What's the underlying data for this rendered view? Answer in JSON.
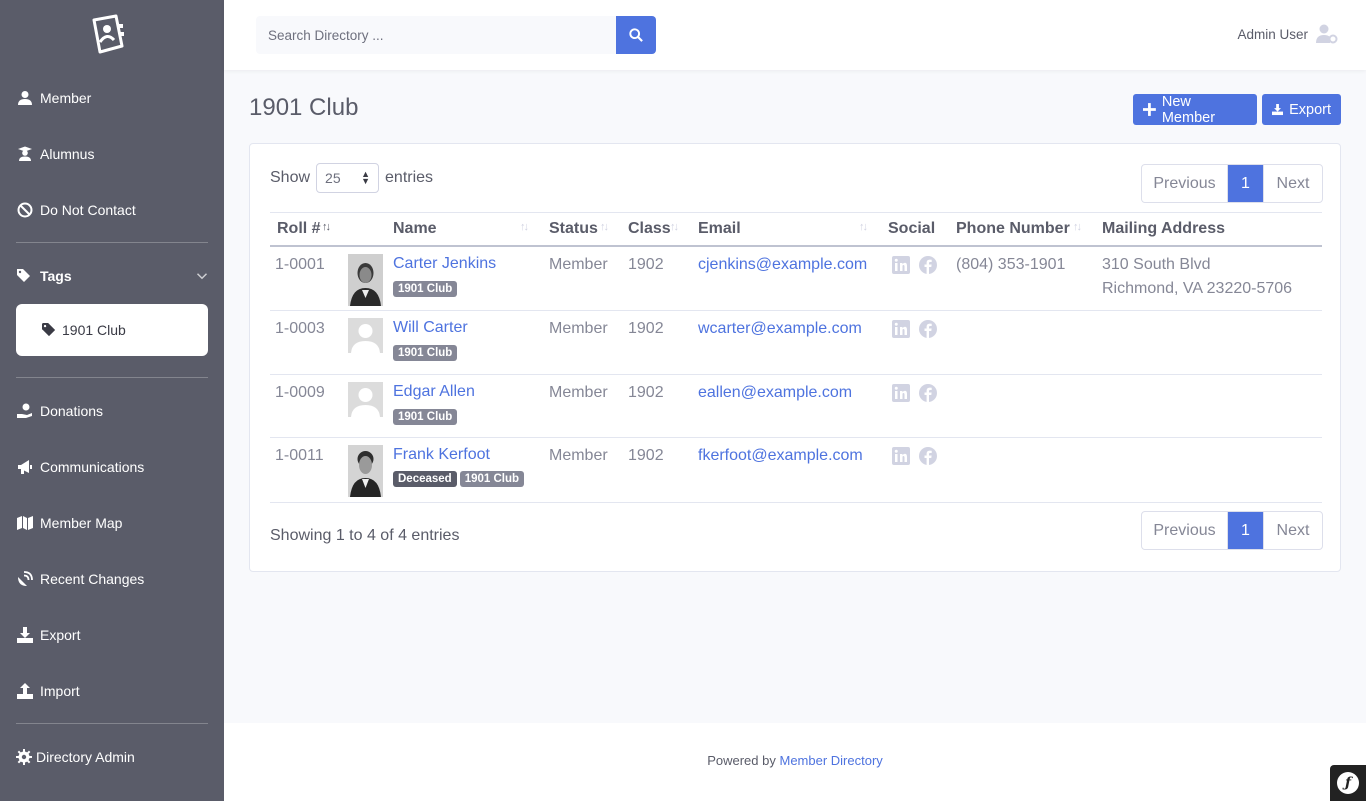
{
  "sidebar": {
    "brand_icon": "contact-book-icon",
    "items": [
      {
        "label": "Member",
        "icon": "user-icon"
      },
      {
        "label": "Alumnus",
        "icon": "graduate-icon"
      },
      {
        "label": "Do Not Contact",
        "icon": "ban-icon"
      },
      {
        "label": "Tags",
        "icon": "tags-icon"
      },
      {
        "label": "1901 Club",
        "icon": "tag-icon"
      },
      {
        "label": "Donations",
        "icon": "donate-icon"
      },
      {
        "label": "Communications",
        "icon": "bullhorn-icon"
      },
      {
        "label": "Member Map",
        "icon": "map-icon"
      },
      {
        "label": "Recent Changes",
        "icon": "satellite-dish-icon"
      },
      {
        "label": "Export",
        "icon": "download-icon"
      },
      {
        "label": "Import",
        "icon": "upload-icon"
      },
      {
        "label": "Directory Admin",
        "icon": "cog-icon"
      }
    ]
  },
  "topbar": {
    "search_placeholder": "Search Directory ...",
    "user_name": "Admin User"
  },
  "page": {
    "title": "1901 Club",
    "new_member_label": "New Member",
    "export_label": "Export"
  },
  "table": {
    "show_label": "Show",
    "entries_label": "entries",
    "page_length": "25",
    "pager": {
      "previous": "Previous",
      "current": "1",
      "next": "Next"
    },
    "columns": [
      "Roll #",
      "Name",
      "Status",
      "Class",
      "Email",
      "Social",
      "Phone Number",
      "Mailing Address"
    ],
    "rows": [
      {
        "roll": "1-0001",
        "name": "Carter Jenkins",
        "badges": [
          "1901 Club"
        ],
        "status": "Member",
        "class": "1902",
        "email": "cjenkins@example.com",
        "phone": "(804) 353-1901",
        "address1": "310 South Blvd",
        "address2": "Richmond, VA 23220-5706"
      },
      {
        "roll": "1-0003",
        "name": "Will Carter",
        "badges": [
          "1901 Club"
        ],
        "status": "Member",
        "class": "1902",
        "email": "wcarter@example.com",
        "phone": "",
        "address1": "",
        "address2": ""
      },
      {
        "roll": "1-0009",
        "name": "Edgar Allen",
        "badges": [
          "1901 Club"
        ],
        "status": "Member",
        "class": "1902",
        "email": "eallen@example.com",
        "phone": "",
        "address1": "",
        "address2": ""
      },
      {
        "roll": "1-0011",
        "name": "Frank Kerfoot",
        "badges": [
          "Deceased",
          "1901 Club"
        ],
        "status": "Member",
        "class": "1902",
        "email": "fkerfoot@example.com",
        "phone": "",
        "address1": "",
        "address2": ""
      }
    ],
    "info": "Showing 1 to 4 of 4 entries"
  },
  "footer": {
    "powered_by": "Powered by",
    "link_label": "Member Directory"
  },
  "colors": {
    "sidebar": "#5a5c69",
    "primary": "#4e73df",
    "badge": "#858796"
  }
}
